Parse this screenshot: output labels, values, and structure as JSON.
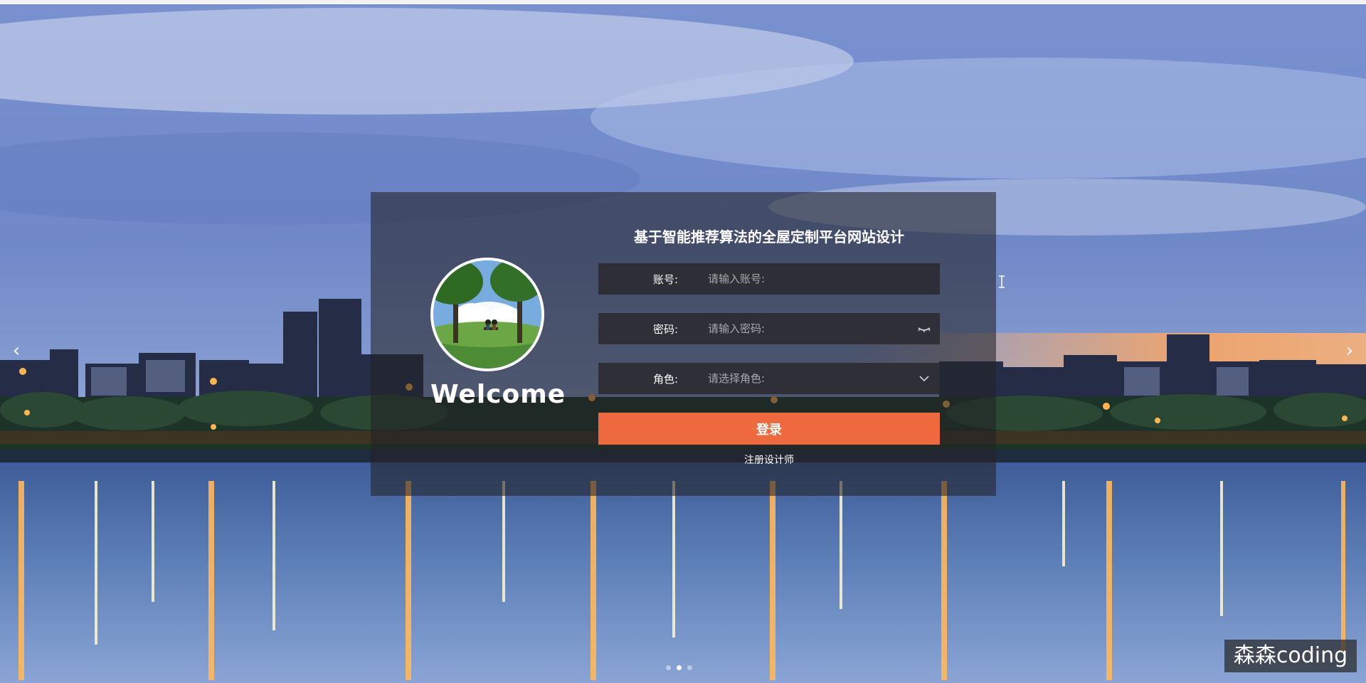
{
  "panel": {
    "title": "基于智能推荐算法的全屋定制平台网站设计",
    "welcome": "Welcome",
    "account_label": "账号:",
    "account_placeholder": "请输入账号:",
    "password_label": "密码:",
    "password_placeholder": "请输入密码:",
    "role_label": "角色:",
    "role_placeholder": "请选择角色:",
    "login_label": "登录",
    "register_label": "注册设计师"
  },
  "carousel": {
    "prev_icon": "chevron-left-icon",
    "next_icon": "chevron-right-icon",
    "dots": [
      {
        "state": "inactive"
      },
      {
        "state": "active"
      },
      {
        "state": "inactive"
      }
    ]
  },
  "watermark": {
    "text": "森森coding"
  },
  "colors": {
    "button": "#ee6a3e",
    "panel_bg": "rgba(35,35,38,0.58)",
    "input_bg": "rgba(42,42,48,0.88)"
  }
}
